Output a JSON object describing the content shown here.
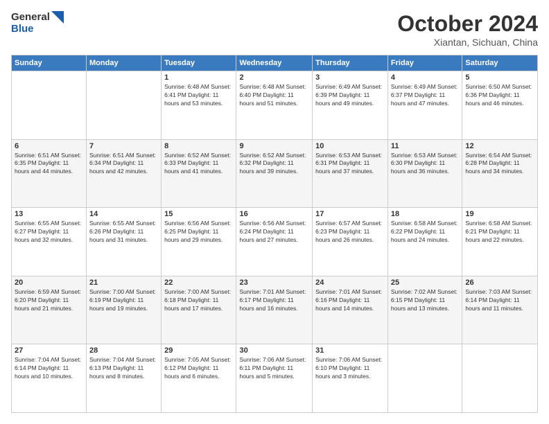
{
  "logo": {
    "line1": "General",
    "line2": "Blue"
  },
  "title": "October 2024",
  "location": "Xiantan, Sichuan, China",
  "headers": [
    "Sunday",
    "Monday",
    "Tuesday",
    "Wednesday",
    "Thursday",
    "Friday",
    "Saturday"
  ],
  "weeks": [
    [
      {
        "day": "",
        "info": ""
      },
      {
        "day": "",
        "info": ""
      },
      {
        "day": "1",
        "info": "Sunrise: 6:48 AM\nSunset: 6:41 PM\nDaylight: 11 hours and 53 minutes."
      },
      {
        "day": "2",
        "info": "Sunrise: 6:48 AM\nSunset: 6:40 PM\nDaylight: 11 hours and 51 minutes."
      },
      {
        "day": "3",
        "info": "Sunrise: 6:49 AM\nSunset: 6:39 PM\nDaylight: 11 hours and 49 minutes."
      },
      {
        "day": "4",
        "info": "Sunrise: 6:49 AM\nSunset: 6:37 PM\nDaylight: 11 hours and 47 minutes."
      },
      {
        "day": "5",
        "info": "Sunrise: 6:50 AM\nSunset: 6:36 PM\nDaylight: 11 hours and 46 minutes."
      }
    ],
    [
      {
        "day": "6",
        "info": "Sunrise: 6:51 AM\nSunset: 6:35 PM\nDaylight: 11 hours and 44 minutes."
      },
      {
        "day": "7",
        "info": "Sunrise: 6:51 AM\nSunset: 6:34 PM\nDaylight: 11 hours and 42 minutes."
      },
      {
        "day": "8",
        "info": "Sunrise: 6:52 AM\nSunset: 6:33 PM\nDaylight: 11 hours and 41 minutes."
      },
      {
        "day": "9",
        "info": "Sunrise: 6:52 AM\nSunset: 6:32 PM\nDaylight: 11 hours and 39 minutes."
      },
      {
        "day": "10",
        "info": "Sunrise: 6:53 AM\nSunset: 6:31 PM\nDaylight: 11 hours and 37 minutes."
      },
      {
        "day": "11",
        "info": "Sunrise: 6:53 AM\nSunset: 6:30 PM\nDaylight: 11 hours and 36 minutes."
      },
      {
        "day": "12",
        "info": "Sunrise: 6:54 AM\nSunset: 6:28 PM\nDaylight: 11 hours and 34 minutes."
      }
    ],
    [
      {
        "day": "13",
        "info": "Sunrise: 6:55 AM\nSunset: 6:27 PM\nDaylight: 11 hours and 32 minutes."
      },
      {
        "day": "14",
        "info": "Sunrise: 6:55 AM\nSunset: 6:26 PM\nDaylight: 11 hours and 31 minutes."
      },
      {
        "day": "15",
        "info": "Sunrise: 6:56 AM\nSunset: 6:25 PM\nDaylight: 11 hours and 29 minutes."
      },
      {
        "day": "16",
        "info": "Sunrise: 6:56 AM\nSunset: 6:24 PM\nDaylight: 11 hours and 27 minutes."
      },
      {
        "day": "17",
        "info": "Sunrise: 6:57 AM\nSunset: 6:23 PM\nDaylight: 11 hours and 26 minutes."
      },
      {
        "day": "18",
        "info": "Sunrise: 6:58 AM\nSunset: 6:22 PM\nDaylight: 11 hours and 24 minutes."
      },
      {
        "day": "19",
        "info": "Sunrise: 6:58 AM\nSunset: 6:21 PM\nDaylight: 11 hours and 22 minutes."
      }
    ],
    [
      {
        "day": "20",
        "info": "Sunrise: 6:59 AM\nSunset: 6:20 PM\nDaylight: 11 hours and 21 minutes."
      },
      {
        "day": "21",
        "info": "Sunrise: 7:00 AM\nSunset: 6:19 PM\nDaylight: 11 hours and 19 minutes."
      },
      {
        "day": "22",
        "info": "Sunrise: 7:00 AM\nSunset: 6:18 PM\nDaylight: 11 hours and 17 minutes."
      },
      {
        "day": "23",
        "info": "Sunrise: 7:01 AM\nSunset: 6:17 PM\nDaylight: 11 hours and 16 minutes."
      },
      {
        "day": "24",
        "info": "Sunrise: 7:01 AM\nSunset: 6:16 PM\nDaylight: 11 hours and 14 minutes."
      },
      {
        "day": "25",
        "info": "Sunrise: 7:02 AM\nSunset: 6:15 PM\nDaylight: 11 hours and 13 minutes."
      },
      {
        "day": "26",
        "info": "Sunrise: 7:03 AM\nSunset: 6:14 PM\nDaylight: 11 hours and 11 minutes."
      }
    ],
    [
      {
        "day": "27",
        "info": "Sunrise: 7:04 AM\nSunset: 6:14 PM\nDaylight: 11 hours and 10 minutes."
      },
      {
        "day": "28",
        "info": "Sunrise: 7:04 AM\nSunset: 6:13 PM\nDaylight: 11 hours and 8 minutes."
      },
      {
        "day": "29",
        "info": "Sunrise: 7:05 AM\nSunset: 6:12 PM\nDaylight: 11 hours and 6 minutes."
      },
      {
        "day": "30",
        "info": "Sunrise: 7:06 AM\nSunset: 6:11 PM\nDaylight: 11 hours and 5 minutes."
      },
      {
        "day": "31",
        "info": "Sunrise: 7:06 AM\nSunset: 6:10 PM\nDaylight: 11 hours and 3 minutes."
      },
      {
        "day": "",
        "info": ""
      },
      {
        "day": "",
        "info": ""
      }
    ]
  ]
}
